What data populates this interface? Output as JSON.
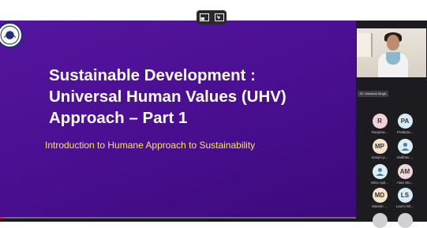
{
  "slide": {
    "title_lines": [
      "Sustainable Development :",
      "Universal Human Values (UHV)",
      "Approach  –  Part 1"
    ],
    "subtitle": "Introduction to Humane Approach to Sustainability",
    "progress": 0.01
  },
  "controls": {
    "icons": [
      "picture-in-picture-icon",
      "exit-fullscreen-icon"
    ]
  },
  "speaker": {
    "name": "Dr. Vanchna Singh"
  },
  "participants": [
    {
      "initials": "R",
      "label": "Ranjana...",
      "color": "#f3cfd7"
    },
    {
      "initials": "PA",
      "label": "Pradipta...",
      "color": "#d7ebf8"
    },
    {
      "initials": "MP",
      "label": "manjiri p...",
      "color": "#f6e3c7"
    },
    {
      "initials": "",
      "label": "Vaibhav ...",
      "color": "#dbeef4",
      "icon": "user-icon"
    },
    {
      "initials": "",
      "label": "Miss Ajal...",
      "color": "#dbeef4",
      "icon": "user-icon"
    },
    {
      "initials": "AM",
      "label": "Atan Mo...",
      "color": "#f0d6d6"
    },
    {
      "initials": "MD",
      "label": "Manish ...",
      "color": "#f6e3c7"
    },
    {
      "initials": "LS",
      "label": "Laxmi Sh...",
      "color": "#d7ebf8"
    }
  ],
  "colors": {
    "slide_bg": "#4b0f93",
    "title_text": "#ffffff",
    "subtitle_text": "#ffe45c",
    "progress_fill": "#d7281f"
  }
}
